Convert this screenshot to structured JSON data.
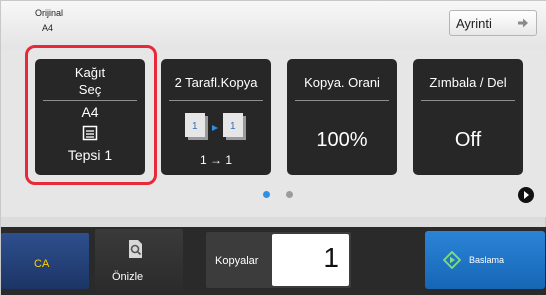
{
  "original": {
    "label": "Orijinal",
    "value": "A4"
  },
  "detail_button": {
    "label": "Ayrinti"
  },
  "tiles": {
    "paper_select": {
      "title_line1": "Kağıt",
      "title_line2": "Seç",
      "size": "A4",
      "tray": "Tepsi 1",
      "icon": "paper-tray-icon"
    },
    "duplex_copy": {
      "title": "2 Tarafl.Kopya",
      "mode": "1 → 1",
      "icon": "duplex-pages-icon"
    },
    "copy_ratio": {
      "title": "Kopya. Orani",
      "value": "100%"
    },
    "staple_punch": {
      "title": "Zımbala / Del",
      "value": "Off"
    }
  },
  "pager": {
    "current_page": 1,
    "total_pages": 2,
    "next_icon": "next-arrow-icon"
  },
  "bottom": {
    "ca_label": "CA",
    "preview_label": "Önizle",
    "preview_icon": "magnifier-page-icon",
    "copies_label": "Kopyalar",
    "copies_value": "1",
    "start_label": "Baslama",
    "start_icon": "diamond-start-icon"
  },
  "colors": {
    "highlight": "#e8283b",
    "tile_bg": "#272727",
    "start_blue": "#1f74c6",
    "ca_blue": "#254683",
    "ca_text": "#ffd200",
    "active_dot": "#2f8fe0"
  }
}
